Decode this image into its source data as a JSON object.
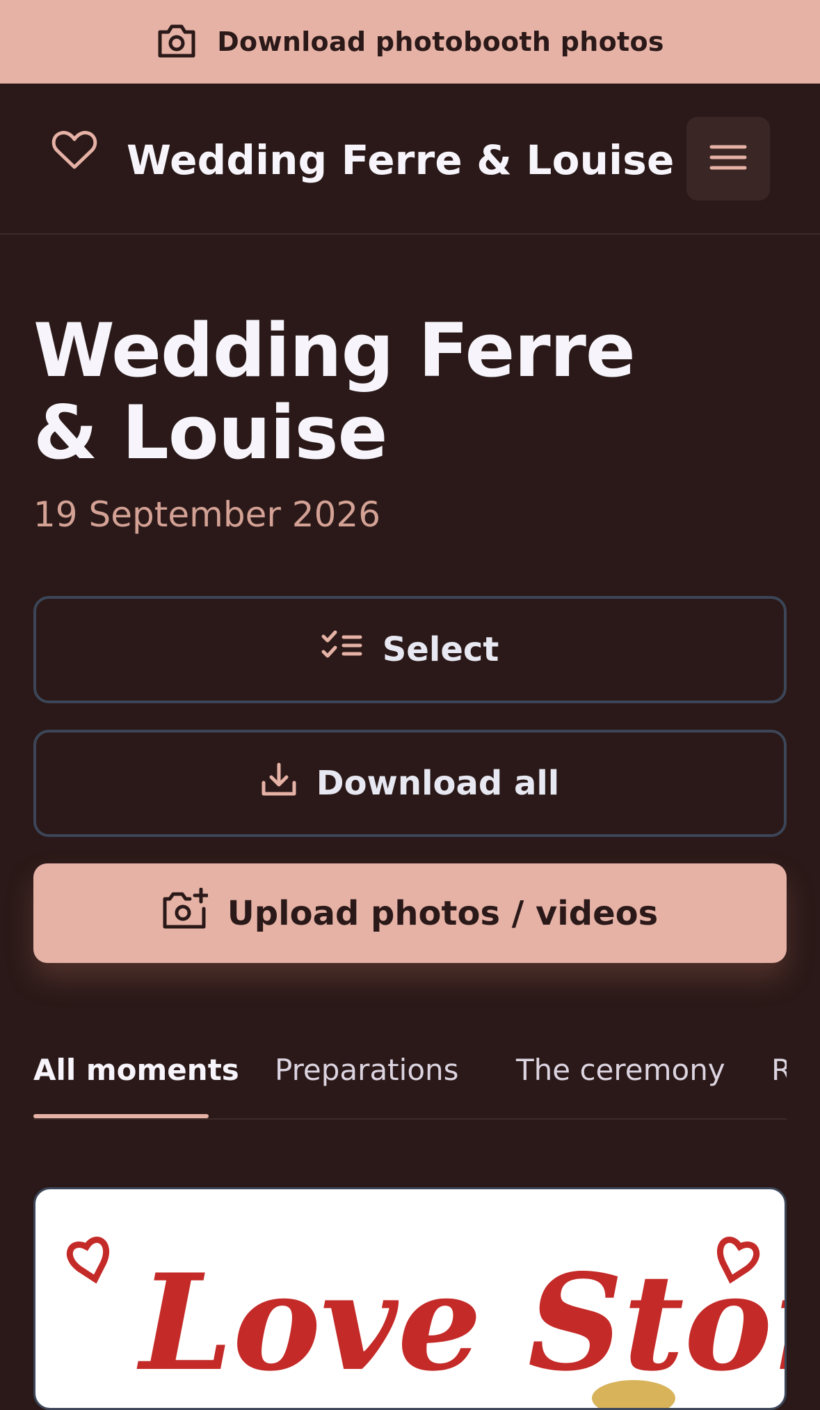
{
  "banner": {
    "label": "Download photobooth photos",
    "icon": "camera-icon"
  },
  "header": {
    "title": "Wedding Ferre & Louise",
    "icon": "heart-icon",
    "menu_icon": "hamburger-menu-icon"
  },
  "hero": {
    "title": "Wedding Ferre & Louise",
    "date": "19 September 2026"
  },
  "actions": {
    "select_label": "Select",
    "download_all_label": "Download all",
    "upload_label": "Upload photos / videos"
  },
  "tabs": [
    {
      "label": "All moments",
      "active": true
    },
    {
      "label": "Preparations",
      "active": false
    },
    {
      "label": "The ceremony",
      "active": false
    },
    {
      "label": "R",
      "active": false
    }
  ],
  "photo": {
    "image_text": "Love Story"
  },
  "colors": {
    "background": "#2a1918",
    "accent": "#e6b2a6",
    "muted_accent": "#d4a195",
    "outline": "#3c4658",
    "photo_text": "#c42a27"
  }
}
